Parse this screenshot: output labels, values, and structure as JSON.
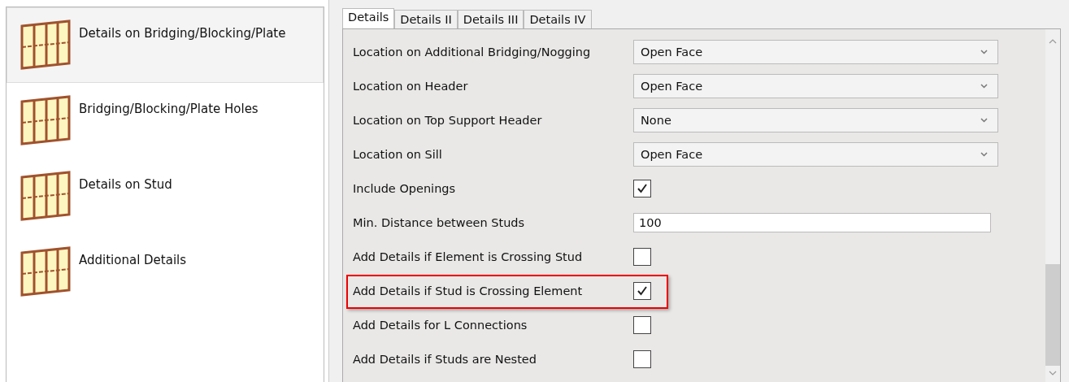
{
  "sidebar": {
    "items": [
      {
        "label": "Details on Bridging/Blocking/Plate",
        "selected": true
      },
      {
        "label": "Bridging/Blocking/Plate Holes",
        "selected": false
      },
      {
        "label": "Details on Stud",
        "selected": false
      },
      {
        "label": "Additional Details",
        "selected": false
      }
    ]
  },
  "tabs": [
    {
      "label": "Details",
      "selected": true
    },
    {
      "label": "Details II",
      "selected": false
    },
    {
      "label": "Details III",
      "selected": false
    },
    {
      "label": "Details IV",
      "selected": false
    }
  ],
  "properties": [
    {
      "kind": "dropdown",
      "label": "Location on Additional Bridging/Nogging",
      "value": "Open Face",
      "highlighted": false
    },
    {
      "kind": "dropdown",
      "label": "Location on Header",
      "value": "Open Face",
      "highlighted": false
    },
    {
      "kind": "dropdown",
      "label": "Location on Top Support Header",
      "value": "None",
      "highlighted": false
    },
    {
      "kind": "dropdown",
      "label": "Location on Sill",
      "value": "Open Face",
      "highlighted": false
    },
    {
      "kind": "checkbox",
      "label": "Include Openings",
      "checked": true,
      "highlighted": false
    },
    {
      "kind": "text",
      "label": "Min. Distance between Studs",
      "value": "100",
      "highlighted": false
    },
    {
      "kind": "checkbox",
      "label": "Add Details if Element is Crossing Stud",
      "checked": false,
      "highlighted": false
    },
    {
      "kind": "checkbox",
      "label": "Add Details if Stud is Crossing Element",
      "checked": true,
      "highlighted": true
    },
    {
      "kind": "checkbox",
      "label": "Add Details for L Connections",
      "checked": false,
      "highlighted": false
    },
    {
      "kind": "checkbox",
      "label": "Add Details if Studs are Nested",
      "checked": false,
      "highlighted": false
    }
  ]
}
